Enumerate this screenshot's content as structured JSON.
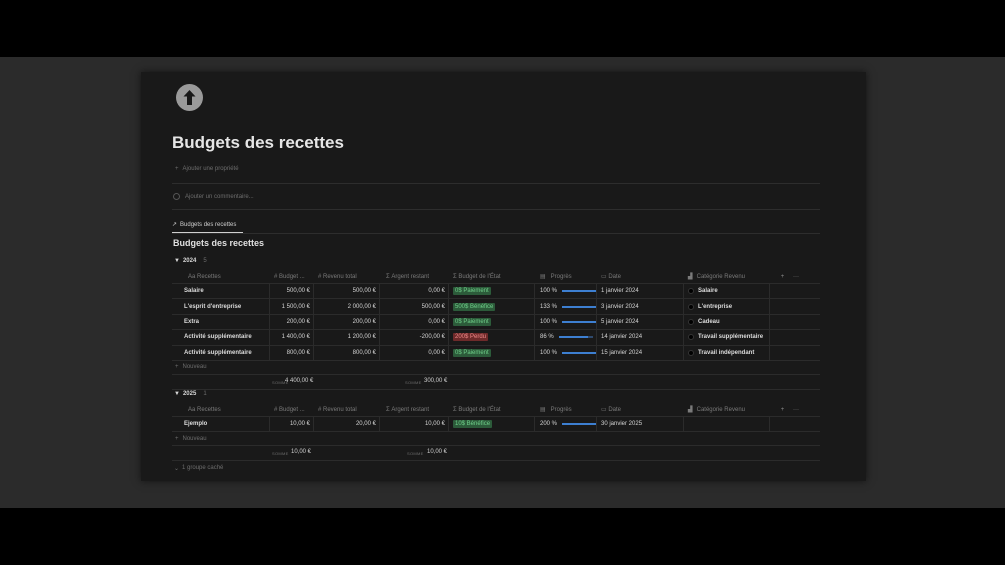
{
  "page": {
    "icon": "arrow-up-circle-icon",
    "title": "Budgets des recettes",
    "add_property": "Ajouter une propriété",
    "add_comment": "Ajouter un commentaire..."
  },
  "view_tab": {
    "label": "Budgets des recettes",
    "icon": "arrow-up-right-icon"
  },
  "database": {
    "title": "Budgets des recettes"
  },
  "columns": {
    "name": "Recettes",
    "name_icon": "Aa",
    "budget": "Budget ...",
    "revenue": "Revenu total",
    "remaining": "Argent restant",
    "state": "Budget de l'État",
    "progress": "Progrès",
    "date": "Date",
    "category": "Catégorie Revenu",
    "num_icon": "#",
    "sum_icon": "Σ",
    "add": "+",
    "more": "···"
  },
  "groups": [
    {
      "name": "2024",
      "count": "5",
      "rows": [
        {
          "name": "Salaire",
          "budget": "500,00 €",
          "revenue": "500,00 €",
          "remaining": "0,00 €",
          "state": "0$ Paiement",
          "state_color": "#2c5b3a",
          "state_text": "#6fcf8a",
          "progress": "100 %",
          "progress_value": 1.0,
          "date": "1 janvier 2024",
          "category": "Salaire"
        },
        {
          "name": "L'esprit d'entreprise",
          "budget": "1 500,00 €",
          "revenue": "2 000,00 €",
          "remaining": "500,00 €",
          "state": "500$ Bénéfice",
          "state_color": "#2c5b3a",
          "state_text": "#6fcf8a",
          "progress": "133 %",
          "progress_value": 1.0,
          "date": "3 janvier 2024",
          "category": "L'entreprise"
        },
        {
          "name": "Extra",
          "budget": "200,00 €",
          "revenue": "200,00 €",
          "remaining": "0,00 €",
          "state": "0$ Paiement",
          "state_color": "#2c5b3a",
          "state_text": "#6fcf8a",
          "progress": "100 %",
          "progress_value": 1.0,
          "date": "5 janvier 2024",
          "category": "Cadeau"
        },
        {
          "name": "Activité supplémentaire",
          "budget": "1 400,00 €",
          "revenue": "1 200,00 €",
          "remaining": "-200,00 €",
          "state": "200$ Perdu",
          "state_color": "#6e2a2a",
          "state_text": "#f08a8a",
          "progress": "86 %",
          "progress_value": 0.86,
          "date": "14 janvier 2024",
          "category": "Travail supplémentaire"
        },
        {
          "name": "Activité supplémentaire",
          "budget": "800,00 €",
          "revenue": "800,00 €",
          "remaining": "0,00 €",
          "state": "0$ Paiement",
          "state_color": "#2c5b3a",
          "state_text": "#6fcf8a",
          "progress": "100 %",
          "progress_value": 1.0,
          "date": "15 janvier 2024",
          "category": "Travail indépendant"
        }
      ],
      "sum_label_1": "SOMME",
      "sum_budget": "4 400,00 €",
      "sum_label_2": "SOMME",
      "sum_remaining": "300,00 €",
      "new_label": "Nouveau"
    },
    {
      "name": "2025",
      "count": "1",
      "rows": [
        {
          "name": "Ejemplo",
          "budget": "10,00 €",
          "revenue": "20,00 €",
          "remaining": "10,00 €",
          "state": "10$ Bénéfice",
          "state_color": "#2c5b3a",
          "state_text": "#6fcf8a",
          "progress": "200 %",
          "progress_value": 1.0,
          "date": "30 janvier 2025",
          "category": ""
        }
      ],
      "sum_label_1": "SOMME",
      "sum_budget": "10,00 €",
      "sum_label_2": "SOMME",
      "sum_remaining": "10,00 €",
      "new_label": "Nouveau"
    }
  ],
  "hidden_groups": "1 groupe caché"
}
